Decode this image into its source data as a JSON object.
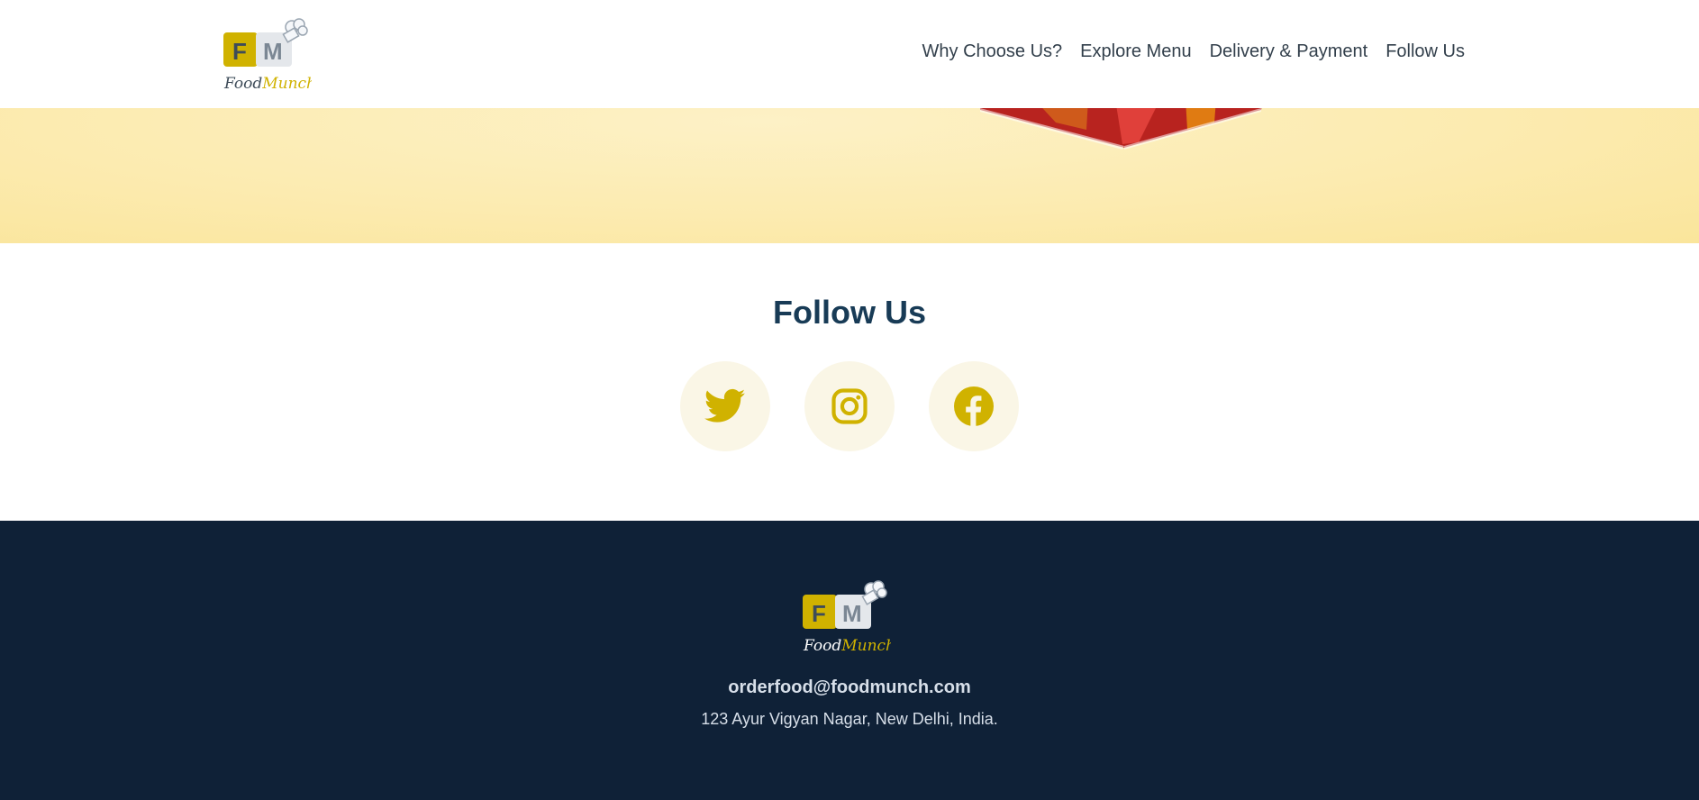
{
  "brand": {
    "monogram_left": "F",
    "monogram_right": "M",
    "word_part1": "Food",
    "word_part2": "Munch"
  },
  "nav": {
    "links": [
      "Why Choose Us?",
      "Explore Menu",
      "Delivery & Payment",
      "Follow Us"
    ]
  },
  "follow": {
    "heading": "Follow Us",
    "icons": [
      "twitter-icon",
      "instagram-icon",
      "facebook-icon"
    ]
  },
  "footer": {
    "email": "orderfood@foodmunch.com",
    "address": "123 Ayur Vigyan Nagar, New Delhi, India."
  },
  "colors": {
    "accent": "#d0b200",
    "heading": "#183b56",
    "footer_bg": "#0f2137",
    "banner_bg": "#fcebb0",
    "social_bg": "#faf6e6"
  }
}
